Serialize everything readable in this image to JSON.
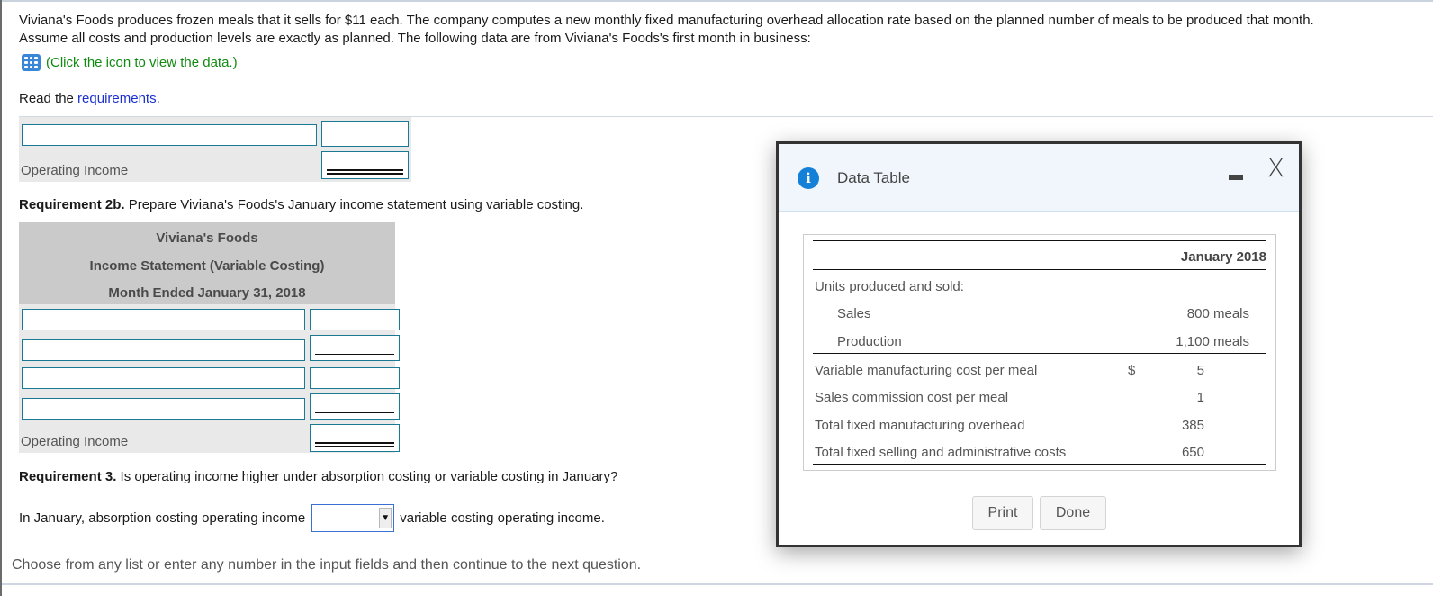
{
  "problem": {
    "intro_line1": "Viviana's Foods produces frozen meals that it sells for $11 each. The company computes a new monthly fixed manufacturing overhead allocation rate based on the planned number of meals to be produced that month.",
    "intro_line2": "Assume all costs and production levels are exactly as planned. The following data are from Viviana's Foods's first month in business:",
    "data_link": "(Click the icon to view the data.)",
    "read_prefix": "Read the ",
    "requirements_link": "requirements",
    "read_suffix": "."
  },
  "req2a_tail": {
    "operating_income_label": "Operating Income"
  },
  "req2b": {
    "title_bold": "Requirement 2b.",
    "title_text": " Prepare Viviana's Foods's January income statement using variable costing.",
    "header_company": "Viviana's Foods",
    "header_statement": "Income Statement (Variable Costing)",
    "header_period": "Month Ended January 31, 2018",
    "rows": [
      {
        "label": "",
        "amount": ""
      },
      {
        "label": "",
        "amount": ""
      },
      {
        "label": "",
        "amount": ""
      },
      {
        "label": "",
        "amount": ""
      }
    ],
    "operating_income_label": "Operating Income"
  },
  "req3": {
    "title_bold": "Requirement 3.",
    "title_text": " Is operating income higher under absorption costing or variable costing in January?",
    "sentence_before": "In January, absorption costing operating income",
    "selected_value": "",
    "sentence_after": "variable costing operating income."
  },
  "footer": {
    "instruction": "Choose from any list or enter any number in the input fields and then continue to the next question."
  },
  "modal": {
    "title": "Data Table",
    "info_icon_glyph": "i",
    "close_glyph": "X",
    "column_header": "January 2018",
    "section_label": "Units produced and sold:",
    "rows": [
      {
        "label": "Sales",
        "currency": "",
        "value": "800 meals"
      },
      {
        "label": "Production",
        "currency": "",
        "value": "1,100 meals"
      },
      {
        "label": "Variable manufacturing cost per meal",
        "currency": "$",
        "value": "5"
      },
      {
        "label": "Sales commission cost per meal",
        "currency": "",
        "value": "1"
      },
      {
        "label": "Total fixed manufacturing overhead",
        "currency": "",
        "value": "385"
      },
      {
        "label": "Total fixed selling and administrative costs",
        "currency": "",
        "value": "650"
      }
    ],
    "print_label": "Print",
    "done_label": "Done"
  },
  "colors": {
    "link_green": "#118a11",
    "link_blue": "#1b32d0",
    "input_border": "#1a7a93",
    "modal_header_bg": "#f1f6fd",
    "info_blue": "#1580d8"
  }
}
